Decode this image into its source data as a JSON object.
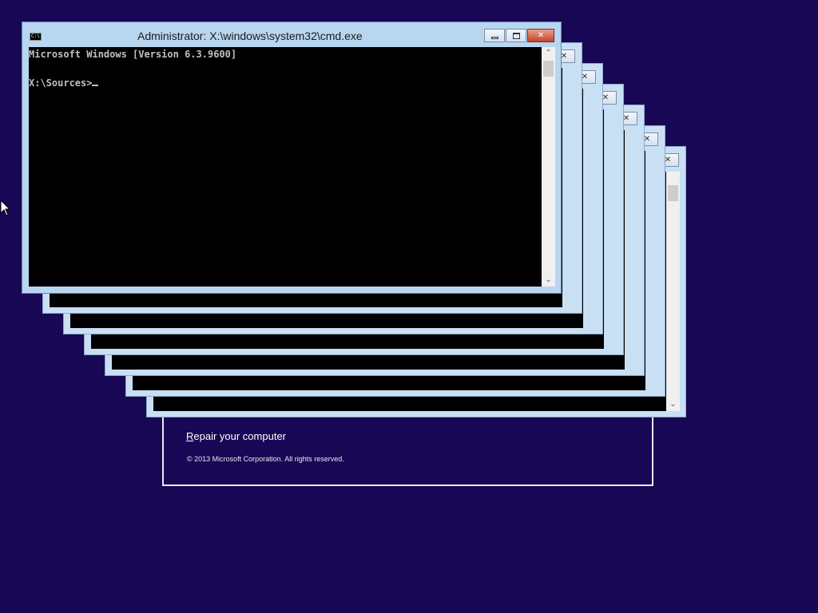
{
  "window": {
    "title": "Administrator: X:\\windows\\system32\\cmd.exe",
    "icon_text": "C:\\",
    "console_line1": "Microsoft Windows [Version 6.3.9600]",
    "console_prompt": "X:\\Sources>"
  },
  "setup": {
    "repair_first": "R",
    "repair_rest": "epair your computer",
    "copyright": "© 2013 Microsoft Corporation. All rights reserved."
  },
  "icons": {
    "minimize": "minimize-icon",
    "maximize": "maximize-icon",
    "close": "close-icon",
    "scroll_up": "chevron-up-icon",
    "scroll_down": "chevron-down-icon",
    "mouse": "mouse-pointer-icon"
  },
  "colors": {
    "desktop": "#180755",
    "console_bg": "#000000",
    "console_text": "#c0c0c0",
    "window_frame": "#b8d6ef",
    "close_button": "#c7432b"
  }
}
